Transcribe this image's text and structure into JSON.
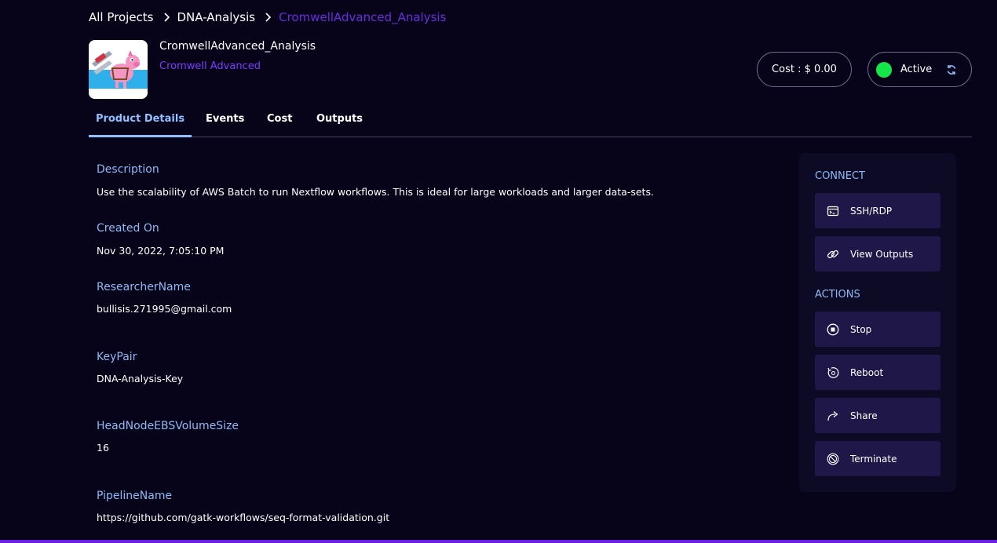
{
  "breadcrumb": {
    "items": [
      "All Projects",
      "DNA-Analysis",
      "CromwellAdvanced_Analysis"
    ]
  },
  "product": {
    "title": "CromwellAdvanced_Analysis",
    "subtitle": "Cromwell Advanced",
    "cost": "Cost : $ 0.00",
    "status": "Active"
  },
  "tabs": [
    "Product Details",
    "Events",
    "Cost",
    "Outputs"
  ],
  "details": {
    "description_label": "Description",
    "description_value": "Use the scalability of AWS Batch to run Nextflow workflows. This is ideal for large workloads and larger data-sets.",
    "created_label": "Created On",
    "created_value": "Nov 30, 2022, 7:05:10 PM",
    "researcher_label": "ResearcherName",
    "researcher_value": "bullisis.271995@gmail.com",
    "keypair_label": "KeyPair",
    "keypair_value": "DNA-Analysis-Key",
    "ebs_label": "HeadNodeEBSVolumeSize",
    "ebs_value": "16",
    "pipeline_label": "PipelineName",
    "pipeline_value": "https://github.com/gatk-workflows/seq-format-validation.git"
  },
  "panel": {
    "connect_title": "CONNECT",
    "connect_buttons": [
      {
        "label": "SSH/RDP",
        "icon": "terminal-icon"
      },
      {
        "label": "View Outputs",
        "icon": "link-icon"
      }
    ],
    "actions_title": "ACTIONS",
    "action_buttons": [
      {
        "label": "Stop",
        "icon": "stop-icon"
      },
      {
        "label": "Reboot",
        "icon": "reboot-icon"
      },
      {
        "label": "Share",
        "icon": "share-icon"
      },
      {
        "label": "Terminate",
        "icon": "terminate-icon"
      }
    ]
  },
  "colors": {
    "background": "#07041a",
    "accent_purple": "#6a2ce0",
    "label_blue": "#8fbaf5",
    "active_green": "#15e64a",
    "button_bg": "#1f1748"
  }
}
